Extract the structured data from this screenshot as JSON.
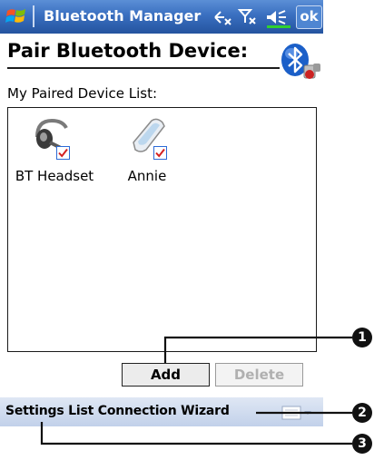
{
  "titlebar": {
    "app_title": "Bluetooth Manager",
    "ok_label": "ok"
  },
  "header": {
    "title": "Pair Bluetooth Device:",
    "subtitle": "My Paired Device List:"
  },
  "devices": [
    {
      "name": "BT Headset",
      "icon": "headset-icon",
      "checked": true
    },
    {
      "name": "Annie",
      "icon": "pda-icon",
      "checked": true
    }
  ],
  "buttons": {
    "add_label": "Add",
    "delete_label": "Delete",
    "delete_enabled": false
  },
  "menubar": {
    "text": "Settings List Connection Wizard"
  },
  "callouts": [
    "1",
    "2",
    "3"
  ],
  "colors": {
    "titlebar": "#2f62b0",
    "menubar": "#c9d6ec",
    "check": "#d42020",
    "checkbox_border": "#2d6bd6"
  }
}
